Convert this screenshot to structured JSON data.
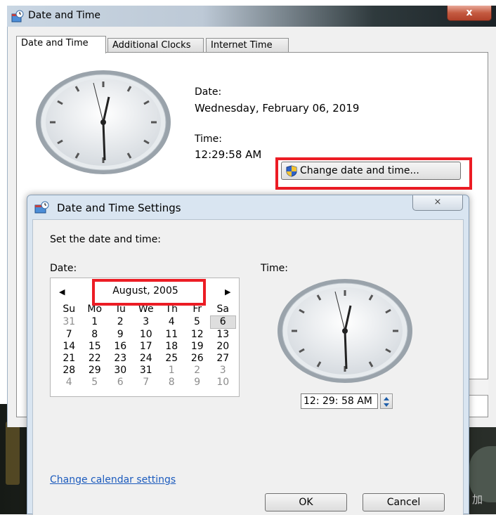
{
  "outer_window": {
    "title": "Date and Time",
    "close_glyph": "x",
    "tabs": [
      {
        "label": "Date and Time",
        "active": true
      },
      {
        "label": "Additional Clocks",
        "active": false
      },
      {
        "label": "Internet Time",
        "active": false
      }
    ],
    "date_label": "Date:",
    "date_value": "Wednesday, February 06, 2019",
    "time_label": "Time:",
    "time_value": "12:29:58 AM",
    "change_button_label": "Change date and time..."
  },
  "dialog": {
    "title": "Date and Time Settings",
    "close_glyph": "⨯",
    "heading": "Set the date and time:",
    "date_label": "Date:",
    "time_label": "Time:",
    "calendar": {
      "prev_glyph": "◀",
      "next_glyph": "▶",
      "month_title": "August, 2005",
      "weekdays": [
        "Su",
        "Mo",
        "Tu",
        "We",
        "Th",
        "Fr",
        "Sa"
      ],
      "weeks": [
        [
          "31",
          "1",
          "2",
          "3",
          "4",
          "5",
          "6"
        ],
        [
          "7",
          "8",
          "9",
          "10",
          "11",
          "12",
          "13"
        ],
        [
          "14",
          "15",
          "16",
          "17",
          "18",
          "19",
          "20"
        ],
        [
          "21",
          "22",
          "23",
          "24",
          "25",
          "26",
          "27"
        ],
        [
          "28",
          "29",
          "30",
          "31",
          "1",
          "2",
          "3"
        ],
        [
          "4",
          "5",
          "6",
          "7",
          "8",
          "9",
          "10"
        ]
      ],
      "selected_day": "6"
    },
    "time_field_value": "12: 29: 58 AM",
    "calendar_settings_link": "Change calendar settings",
    "ok_label": "OK",
    "cancel_label": "Cancel"
  },
  "desktop_glyph": "加",
  "colors": {
    "highlight": "#ec1c24",
    "link": "#1c5bbd",
    "title_blue": "#d9e5f1"
  },
  "icons": [
    "datetime-window-icon",
    "close-icon",
    "clock-face-icon",
    "uac-shield-icon",
    "chevron-left-icon",
    "chevron-right-icon",
    "spinner-up-icon",
    "spinner-down-icon"
  ]
}
